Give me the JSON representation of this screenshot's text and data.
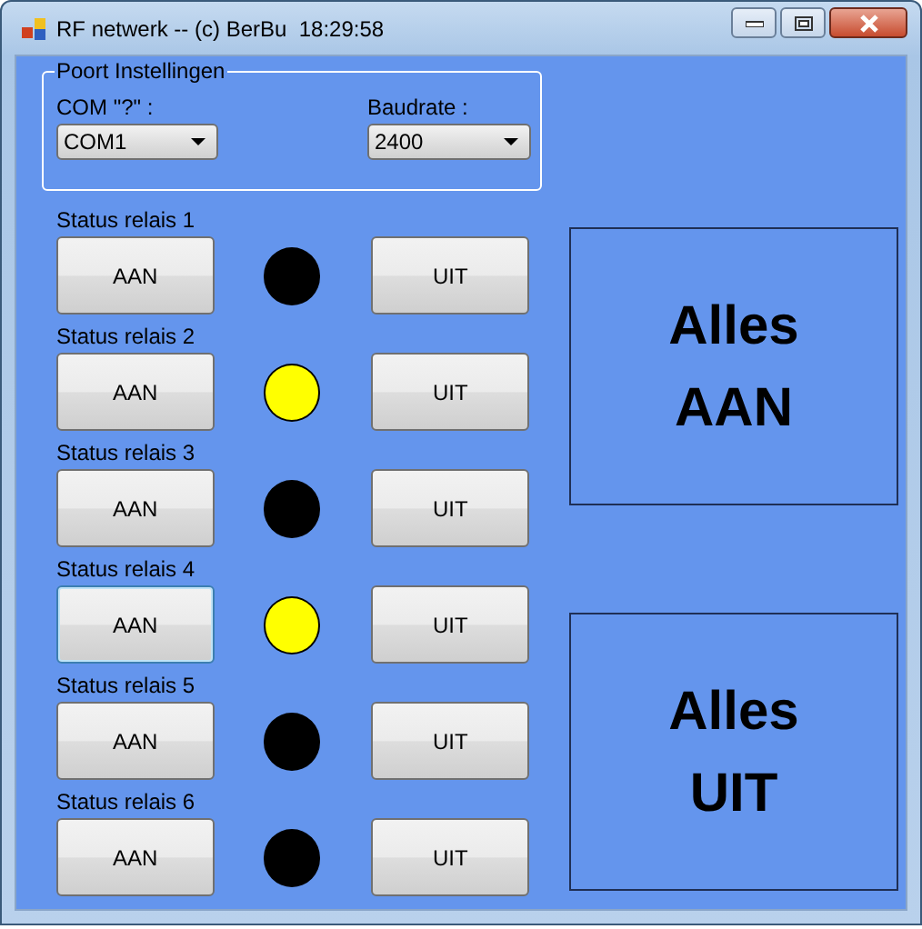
{
  "window": {
    "title": "RF netwerk -- (c) BerBu  18:29:58"
  },
  "port_settings": {
    "title": "Poort Instellingen",
    "com_label": "COM \"?\" :",
    "com_value": "COM1",
    "baud_label": "Baudrate :",
    "baud_value": "2400"
  },
  "relays": [
    {
      "label": "Status relais 1",
      "on_button": "AAN",
      "off_button": "UIT",
      "on": false,
      "focused": false
    },
    {
      "label": "Status relais 2",
      "on_button": "AAN",
      "off_button": "UIT",
      "on": true,
      "focused": false
    },
    {
      "label": "Status relais 3",
      "on_button": "AAN",
      "off_button": "UIT",
      "on": false,
      "focused": false
    },
    {
      "label": "Status relais 4",
      "on_button": "AAN",
      "off_button": "UIT",
      "on": true,
      "focused": true
    },
    {
      "label": "Status relais 5",
      "on_button": "AAN",
      "off_button": "UIT",
      "on": false,
      "focused": false
    },
    {
      "label": "Status relais 6",
      "on_button": "AAN",
      "off_button": "UIT",
      "on": false,
      "focused": false
    }
  ],
  "all_on_button": "Alles AAN",
  "all_off_button": "Alles UIT"
}
